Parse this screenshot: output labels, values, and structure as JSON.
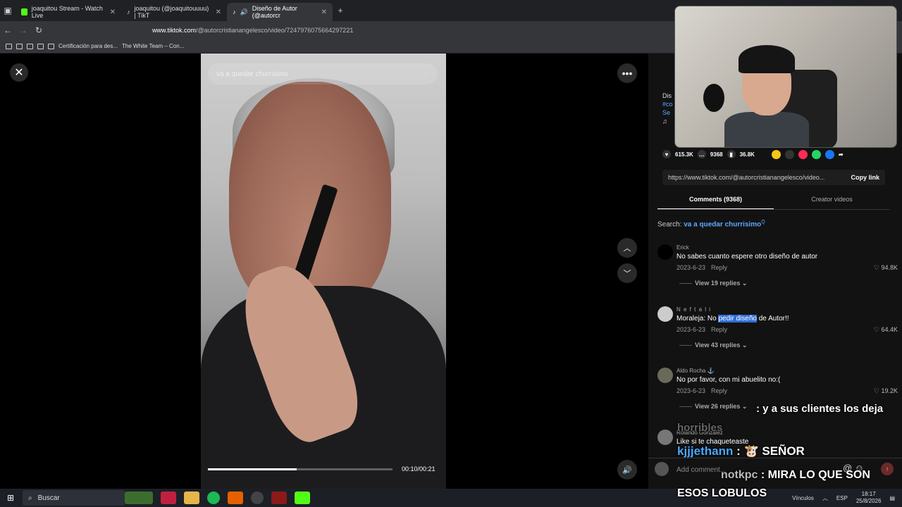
{
  "browser": {
    "tabs": [
      {
        "title": "joaquitou Stream - Watch Live",
        "color": "#53fc18"
      },
      {
        "title": "joaquitou (@joaquitouuuu) | TikT",
        "color": "#ffffff"
      },
      {
        "title": "Diseño de Autor (@autorcr",
        "color": "#ffffff"
      }
    ],
    "new_tab": "+",
    "url_domain": "www.tiktok.com",
    "url_path": "/@autorcristianangelesco/video/7247976075664297221",
    "bookmarks": [
      "Certificación para des...",
      "The White Team – Con..."
    ]
  },
  "video": {
    "search_text": "va a quedar churrisimo",
    "time": "00:10/00:21",
    "progress_fraction": 0.48
  },
  "panel": {
    "partial_lines": [
      "Dis",
      "#co",
      "Se",
      "♫"
    ],
    "likes": "615.3K",
    "comments": "9368",
    "saves": "36.8K",
    "link": "https://www.tiktok.com/@autorcristianangelesco/video...",
    "copy_label": "Copy link",
    "tab_comments": "Comments (9368)",
    "tab_creator": "Creator videos",
    "search_prefix": "Search:",
    "search_term": "va a quedar churrisimo",
    "search_sup": "Q"
  },
  "comments": [
    {
      "user": "Erick",
      "text_before": "No sabes cuanto espere otro diseño de autor",
      "highlight": "",
      "text_after": "",
      "date": "2023-6-23",
      "reply": "Reply",
      "likes": "94.8K",
      "replies": "View 19 replies"
    },
    {
      "user": "N e f t a l i",
      "text_before": "Moraleja: No ",
      "highlight": "pedir diseño",
      "text_after": " de Autor!!",
      "date": "2023-6-23",
      "reply": "Reply",
      "likes": "64.4K",
      "replies": "View 43 replies"
    },
    {
      "user": "Aldo Rocha ⚓",
      "text_before": "No por favor, con mi abuelito no:(",
      "highlight": "",
      "text_after": "",
      "date": "2023-6-23",
      "reply": "Reply",
      "likes": "19.2K",
      "replies": "View 26 replies"
    },
    {
      "user": "Rolando González",
      "text_before": "Like si te chaqueteaste",
      "highlight": "",
      "text_after": "",
      "date": "",
      "reply": "",
      "likes": "",
      "replies": ""
    }
  ],
  "chat_overlay": {
    "line1": ": y a sus clientes los deja",
    "line1b": "horribles",
    "line2_user": "kjjjethann",
    "line2_msg": ": 🐮 SEÑOR",
    "line3_user": "notkpc",
    "line3_msg": ": MIRA LO QUE SON",
    "line4": "ESOS LOBULOS"
  },
  "add_comment_placeholder": "Add comment...",
  "taskbar": {
    "search": "Buscar",
    "links": "Vínculos",
    "lang": "ESP",
    "time": "18:17",
    "date": "25/8/2026"
  }
}
